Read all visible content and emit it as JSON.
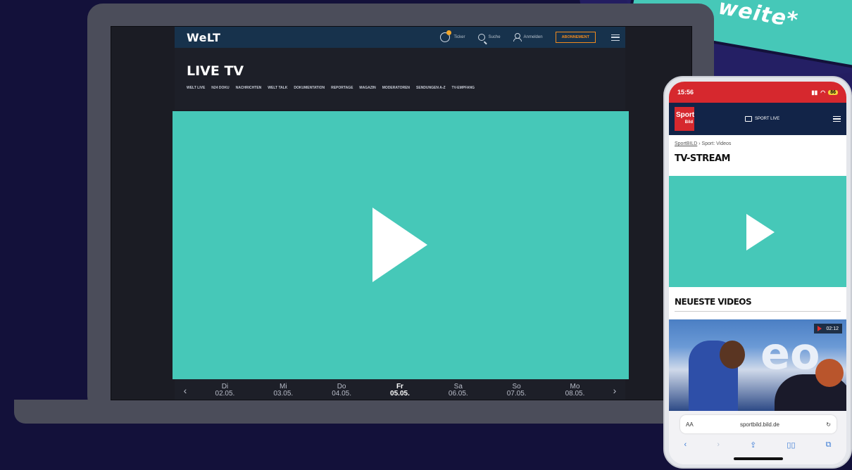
{
  "banner": {
    "text": "weite*"
  },
  "laptop": {
    "header": {
      "logo": "WeLT",
      "ticker_label": "Ticker",
      "search_label": "Suche",
      "login_label": "Anmelden",
      "abo_label": "ABONNEMENT"
    },
    "title": "LIVE TV",
    "subnav": [
      "WELT LIVE",
      "N24 DOKU",
      "NACHRICHTEN",
      "WELT TALK",
      "DOKUMENTATION",
      "REPORTAGE",
      "MAGAZIN",
      "MODERATOREN",
      "SENDUNGEN A-Z",
      "TV-EMPFANG"
    ],
    "dates": [
      {
        "day": "Di",
        "date": "02.05."
      },
      {
        "day": "Mi",
        "date": "03.05."
      },
      {
        "day": "Do",
        "date": "04.05."
      },
      {
        "day": "Fr",
        "date": "05.05."
      },
      {
        "day": "Sa",
        "date": "06.05."
      },
      {
        "day": "So",
        "date": "07.05."
      },
      {
        "day": "Mo",
        "date": "08.05."
      }
    ],
    "prev_arrow": "‹",
    "next_arrow": "›"
  },
  "phone": {
    "time": "15:56",
    "battery": "86",
    "logo_top": "Sport",
    "logo_bottom": "Bild",
    "live_label": "SPORT LIVE",
    "breadcrumb_root": "SportBILD",
    "breadcrumb_rest": "› Sport: Videos",
    "stream_title": "TV-STREAM",
    "latest_title": "NEUESTE VIDEOS",
    "video_duration": "02:12",
    "thumb_brand": "eo",
    "url_aa": "AA",
    "url": "sportbild.bild.de",
    "reload": "↻",
    "toolbar": [
      "‹",
      "›",
      "⇪",
      "▯▯",
      "⧉"
    ]
  },
  "colors": {
    "accent_teal": "#46c8b8",
    "welt_header": "#17324c",
    "bild_red": "#d6282e",
    "bild_navy": "#122448"
  }
}
